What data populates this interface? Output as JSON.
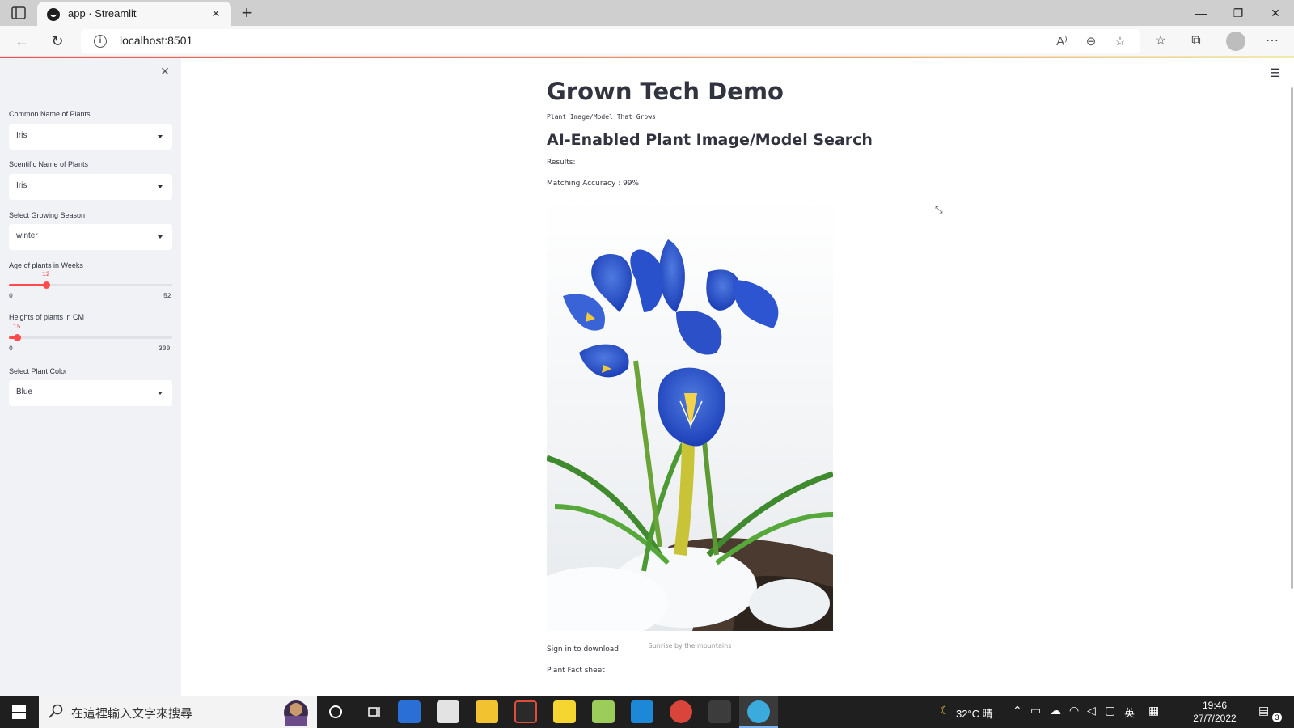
{
  "browser": {
    "tab_title": "app · Streamlit",
    "url": "localhost:8501"
  },
  "sidebar": {
    "common_name": {
      "label": "Common Name of Plants",
      "value": "Iris"
    },
    "scientific_name": {
      "label": "Scentific Name of Plants",
      "value": "Iris"
    },
    "season": {
      "label": "Select Growing Season",
      "value": "winter"
    },
    "age": {
      "label": "Age of plants in Weeks",
      "value": "12",
      "min": "0",
      "max": "52",
      "fraction": 0.23
    },
    "height": {
      "label": "Heights of plants in CM",
      "value": "15",
      "min": "0",
      "max": "300",
      "fraction": 0.05
    },
    "color": {
      "label": "Select Plant Color",
      "value": "Blue"
    }
  },
  "main": {
    "title": "Grown Tech Demo",
    "subtitle": "Plant Image/Model That Grows",
    "heading": "AI-Enabled Plant Image/Model Search",
    "results_label": "Results:",
    "accuracy": "Matching Accuracy : 99%",
    "image_caption": "Sunrise by the mountains",
    "sign_in": "Sign in to download",
    "fact_sheet": "Plant Fact sheet"
  },
  "taskbar": {
    "search_placeholder": "在這裡輸入文字來搜尋",
    "weather": "32°C 晴",
    "ime": "英",
    "time": "19:46",
    "date": "27/7/2022",
    "notifications": "3"
  },
  "colors": {
    "accent": "#ff4b4b",
    "sidebar_bg": "#f0f2f6",
    "text": "#31333f"
  }
}
